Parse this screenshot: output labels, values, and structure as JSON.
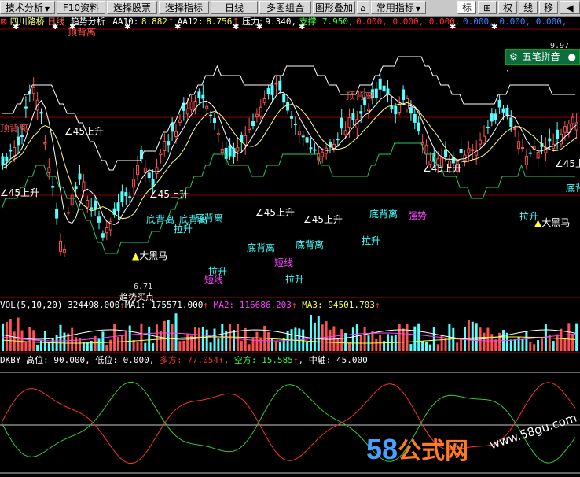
{
  "toolbar": {
    "items": [
      {
        "label": "技术分析"
      },
      {
        "label": "F10资料"
      },
      {
        "label": "选择股票"
      },
      {
        "label": "选择指标"
      },
      {
        "label": "日线"
      },
      {
        "label": "多图组合"
      },
      {
        "label": "图形叠加"
      },
      {
        "label": "常用指标"
      }
    ],
    "right": [
      "标",
      "权",
      "线",
      "移"
    ]
  },
  "main": {
    "stock": "四川路桥",
    "period": "日线",
    "indicator": "趋势分析",
    "aa10_label": "AA10:",
    "aa10_value": "8.882",
    "aa12_label": "AA12:",
    "aa12_value": "8.756",
    "pressure_label": "压力:",
    "pressure_value": "9.340,",
    "support_label": "支撑:",
    "support_value": "7.950,",
    "zeros_red": "0.000, 0.000, 0.000,",
    "zeros_blue": "0.000, 0.000, 0.000,",
    "high_price": "9.97",
    "low_price": "6.71",
    "labels": {
      "top_div": "顶背离",
      "bottom_div": "底背离",
      "up45": "45上升",
      "lift": "拉升",
      "short": "短线",
      "horse": "大黑马",
      "strong": "强势",
      "buy_point": "趋势买点"
    }
  },
  "vol": {
    "title": "VOL(5,10,20)",
    "value": "324498.000",
    "ma1_label": "MA1:",
    "ma1": "175571.000",
    "ma2_label": "MA2:",
    "ma2": "116686.203",
    "ma3_label": "MA3:",
    "ma3": "94501.703"
  },
  "kdj": {
    "title": "DKBY",
    "high_label": "高位:",
    "high": "90.000,",
    "low_label": "低位:",
    "low": "0.000,",
    "long_label": "多方:",
    "long": "77.054",
    "short_label": "空方:",
    "short": "15.585",
    "mid_label": "中轴:",
    "mid": "45.000"
  },
  "ime": {
    "label": "五笔拼音"
  },
  "watermark": {
    "number": "58",
    "word": "公式网",
    "url": "www.58gu.com"
  },
  "colors": {
    "up": "#ff5050",
    "down": "#54ffff",
    "support": "#22cc66",
    "pressure": "#ffffff",
    "kdj_long": "#ff3030",
    "kdj_short": "#33cc33"
  }
}
